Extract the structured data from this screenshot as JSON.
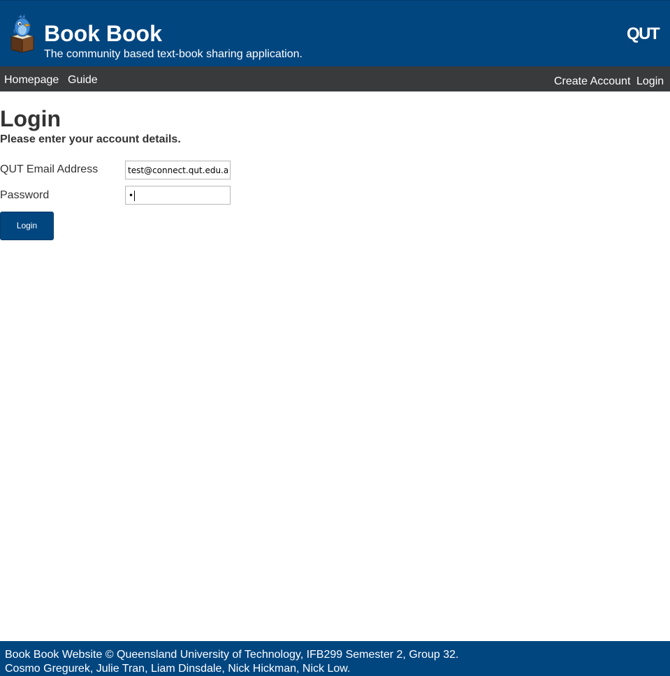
{
  "header": {
    "title": "Book Book",
    "tagline": "The community based text-book sharing application.",
    "institution_logo": "QUT",
    "logo_icon": "bird-on-book-icon"
  },
  "nav": {
    "left": [
      "Homepage",
      "Guide"
    ],
    "right": [
      "Create Account",
      "Login"
    ]
  },
  "main": {
    "title": "Login",
    "subtitle": "Please enter your account details.",
    "email_label": "QUT Email Address",
    "email_value": "test@connect.qut.edu.au",
    "password_label": "Password",
    "password_value": "•",
    "login_button": "Login"
  },
  "footer": {
    "line1": "Book Book Website © Queensland University of Technology, IFB299 Semester 2, Group 32.",
    "line2": "Cosmo Gregurek, Julie Tran, Liam Dinsdale, Nick Hickman, Nick Low."
  },
  "colors": {
    "brand_blue": "#024680",
    "nav_dark": "#393a3c",
    "text": "#333333"
  }
}
